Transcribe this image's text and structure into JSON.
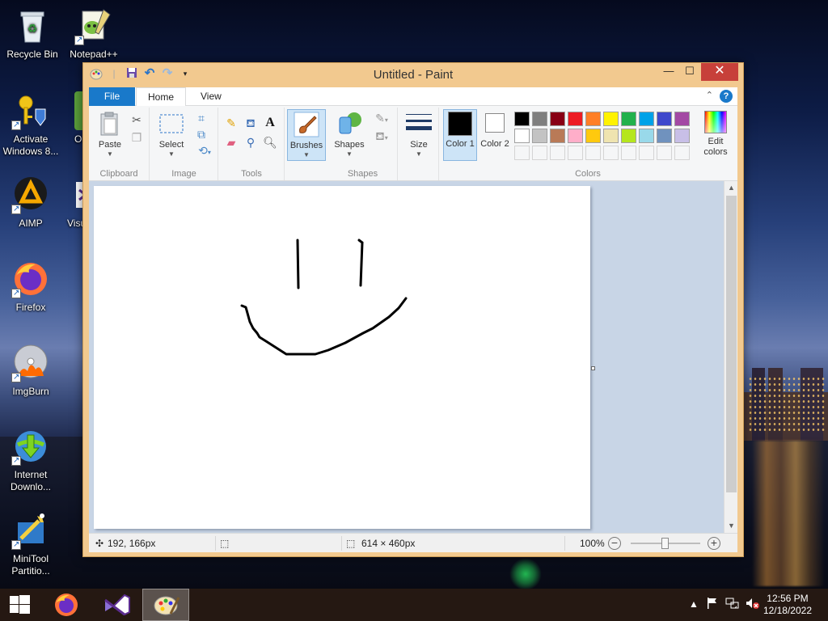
{
  "desktop": {
    "icons": [
      {
        "label": "Recycle Bin",
        "icon": "recycle-bin-icon"
      },
      {
        "label": "Notepad++",
        "icon": "notepadpp-icon"
      },
      {
        "label": "Activate Windows 8...",
        "icon": "activate-key-icon"
      },
      {
        "label": "O",
        "icon": "partial-green-icon"
      },
      {
        "label": "AIMP",
        "icon": "aimp-icon"
      },
      {
        "label": "Visu",
        "icon": "visual-studio-icon"
      },
      {
        "label": "Firefox",
        "icon": "firefox-icon"
      },
      {
        "label": "ImgBurn",
        "icon": "imgburn-icon"
      },
      {
        "label": "Internet Downlo...",
        "icon": "idm-icon"
      },
      {
        "label": "MiniTool Partitio...",
        "icon": "minitool-icon"
      }
    ]
  },
  "window": {
    "title": "Untitled - Paint",
    "controls": {
      "minimize": "—",
      "maximize": "☐",
      "close": "✕"
    }
  },
  "ribbon": {
    "tabs": [
      {
        "label": "File",
        "active": false
      },
      {
        "label": "Home",
        "active": true
      },
      {
        "label": "View",
        "active": false
      }
    ],
    "groups": {
      "clipboard": {
        "label": "Clipboard",
        "paste": "Paste"
      },
      "image": {
        "label": "Image",
        "select": "Select"
      },
      "tools": {
        "label": "Tools"
      },
      "brushes": {
        "label": "Brushes"
      },
      "shapes": {
        "label": "Shapes",
        "shapes_btn": "Shapes"
      },
      "size": {
        "label": "Size"
      },
      "colors": {
        "label": "Colors",
        "color1": "Color 1",
        "color2": "Color 2",
        "edit_colors": "Edit colors",
        "color1_value": "#000000",
        "color2_value": "#ffffff",
        "palette_row1": [
          "#000000",
          "#7f7f7f",
          "#880015",
          "#ed1c24",
          "#ff7f27",
          "#fff200",
          "#22b14c",
          "#00a2e8",
          "#3f48cc",
          "#a349a4"
        ],
        "palette_row2": [
          "#ffffff",
          "#c3c3c3",
          "#b97a57",
          "#ffaec9",
          "#ffc90e",
          "#efe4b0",
          "#b5e61d",
          "#99d9ea",
          "#7092be",
          "#c8bfe7"
        ]
      }
    }
  },
  "status": {
    "cursor_pos": "192, 166px",
    "canvas_size": "614 × 460px",
    "zoom": "100%"
  },
  "taskbar": {
    "apps": [
      "start",
      "firefox",
      "visual-studio",
      "paint"
    ],
    "clock_time": "12:56 PM",
    "clock_date": "12/18/2022"
  }
}
